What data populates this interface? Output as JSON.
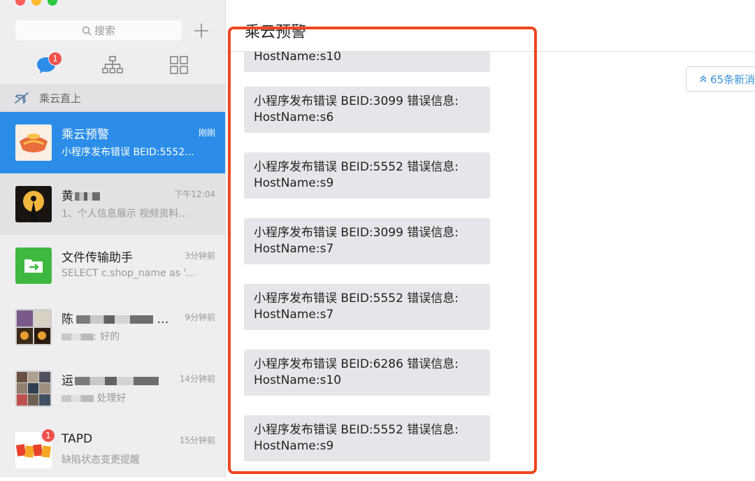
{
  "window": {
    "title": "乘云预警"
  },
  "sidebar": {
    "search_placeholder": "搜索",
    "nav": {
      "chats_badge": "1"
    },
    "group_header": "乘云直上",
    "conversations": [
      {
        "name": "乘云预警",
        "time": "刚刚",
        "preview": "小程序发布错误 BEID:5552...",
        "badge": ""
      },
      {
        "name": "黄",
        "time": "下午12:04",
        "preview": "1、个人信息展示 视频资料...",
        "badge": ""
      },
      {
        "name": "文件传输助手",
        "time": "3分钟前",
        "preview": "SELECT c.shop_name as '...",
        "badge": ""
      },
      {
        "name": "陈",
        "time": "9分钟前",
        "preview": ": 好的",
        "badge": ""
      },
      {
        "name": "运",
        "time": "14分钟前",
        "preview": "处理好",
        "badge": ""
      },
      {
        "name": "TAPD",
        "time": "15分钟前",
        "preview": "缺陷状态变更提醒",
        "badge": "1"
      }
    ]
  },
  "main": {
    "new_messages_button": "65条新消",
    "messages": [
      {
        "text": "HostName:s10"
      },
      {
        "text": "小程序发布错误 BEID:3099 错误信息:\nHostName:s6"
      },
      {
        "text": "小程序发布错误 BEID:5552 错误信息:\nHostName:s9"
      },
      {
        "text": "小程序发布错误 BEID:3099 错误信息:\nHostName:s7"
      },
      {
        "text": "小程序发布错误 BEID:5552 错误信息:\nHostName:s7"
      },
      {
        "text": "小程序发布错误 BEID:6286 错误信息:\nHostName:s10"
      },
      {
        "text": "小程序发布错误 BEID:5552 错误信息:\nHostName:s9"
      }
    ]
  },
  "colors": {
    "accent": "#2b8de8",
    "highlight": "#f0461e",
    "badge": "#f0504d"
  }
}
